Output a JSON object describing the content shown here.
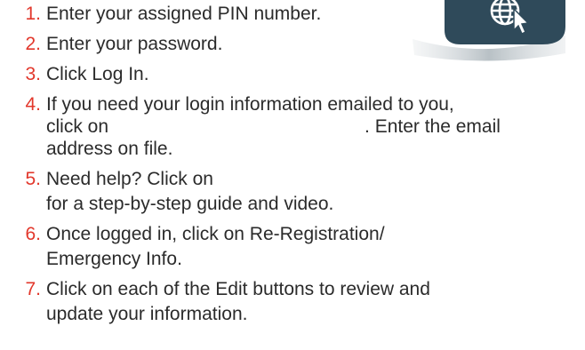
{
  "steps": [
    {
      "num": "1.",
      "lines": [
        "Enter your assigned PIN number."
      ]
    },
    {
      "num": "2.",
      "lines": [
        "Enter your password."
      ]
    },
    {
      "num": "3.",
      "lines": [
        "Click Log In."
      ]
    },
    {
      "num": "4.",
      "lines": [
        "If you need your login information emailed to you,",
        "click on",
        ". Enter the email",
        "address on file."
      ]
    },
    {
      "num": "5.",
      "lines": [
        "Need help? Click on",
        "for a step-by-step guide and video."
      ]
    },
    {
      "num": "6.",
      "lines": [
        "Once logged in, click on Re-Registration/",
        "Emergency Info."
      ]
    },
    {
      "num": "7.",
      "lines": [
        "Click on each of the Edit buttons to review and",
        "update your information."
      ]
    }
  ],
  "colors": {
    "number": "#e2372b",
    "text": "#2b2b2b",
    "badge_dark": "#2f4a5a",
    "badge_light": "#ffffff"
  },
  "icons": {
    "badge": "globe-cursor-icon"
  }
}
